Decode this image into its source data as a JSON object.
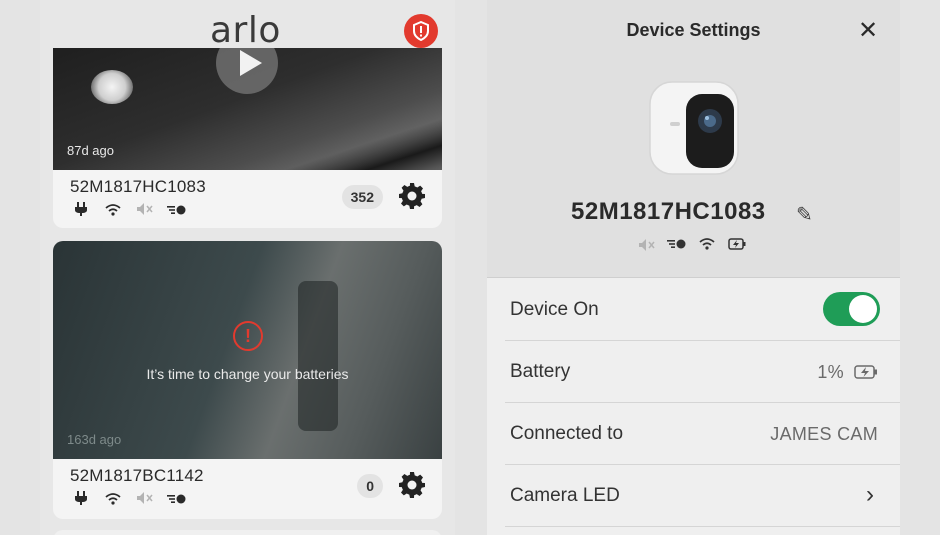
{
  "app": {
    "logo_text": "arlo"
  },
  "cameras": [
    {
      "name": "52M1817HC1083",
      "last_seen": "87d ago",
      "clip_count": "352",
      "status_icons": [
        "power-plug-icon",
        "wifi-icon",
        "speaker-muted-icon",
        "signal-dot-icon"
      ]
    },
    {
      "name": "52M1817BC1142",
      "last_seen": "163d ago",
      "clip_count": "0",
      "warning": "It’s time to change your batteries",
      "status_icons": [
        "power-plug-icon",
        "wifi-icon",
        "speaker-muted-icon",
        "signal-dot-icon"
      ]
    }
  ],
  "device_settings": {
    "title": "Device Settings",
    "device_name": "52M1817HC1083",
    "rows": {
      "device_on": {
        "label": "Device On",
        "value": true
      },
      "battery": {
        "label": "Battery",
        "value": "1%"
      },
      "connected_to": {
        "label": "Connected to",
        "value": "JAMES CAM"
      },
      "camera_led": {
        "label": "Camera LED"
      }
    }
  },
  "colors": {
    "accent_green": "#1f9d57",
    "alert_red": "#e23a2e"
  }
}
